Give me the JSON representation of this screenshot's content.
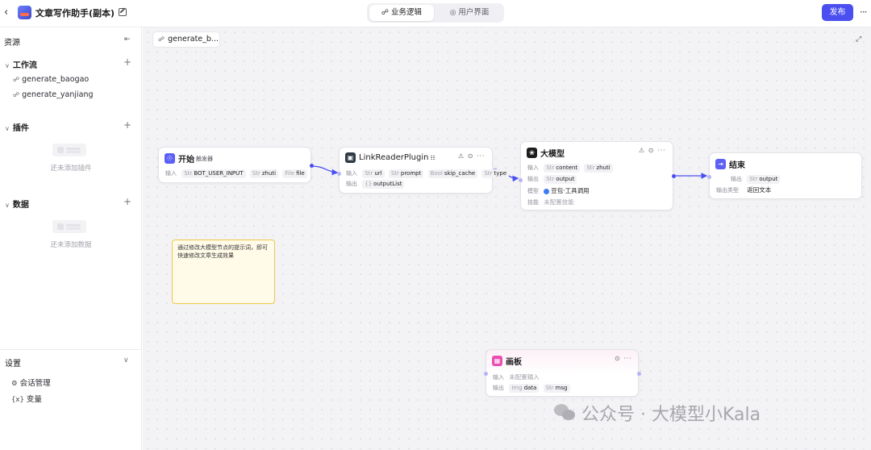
{
  "topbar": {
    "back_icon": "chevron-left-icon",
    "app_title": "文章写作助手(副本)",
    "tabs": [
      {
        "label": "业务逻辑",
        "icon": "workflow-icon",
        "active": true
      },
      {
        "label": "用户界面",
        "icon": "palette-icon",
        "active": false
      }
    ],
    "publish_label": "发布",
    "more_label": "···"
  },
  "sidebar": {
    "header": "资源",
    "workflow": {
      "title": "工作流",
      "items": [
        "generate_baogao",
        "generate_yanjiang"
      ]
    },
    "plugins": {
      "title": "插件",
      "empty_text": "还未添加插件"
    },
    "data": {
      "title": "数据",
      "empty_text": "还未添加数据"
    },
    "settings": {
      "title": "设置",
      "items": [
        {
          "label": "会话管理",
          "icon": "chat-settings-icon",
          "glyph": "⚙"
        },
        {
          "label": "变量",
          "icon": "variable-icon",
          "glyph": "{x}"
        }
      ]
    }
  },
  "canvas": {
    "breadcrumb": "generate_b...",
    "nodes": {
      "start": {
        "title": "开始",
        "badge": "触发器",
        "input_label": "输入",
        "inputs": [
          {
            "type": "Str",
            "name": "BOT_USER_INPUT"
          },
          {
            "type": "Str",
            "name": "zhuti"
          },
          {
            "type": "File",
            "name": "file"
          }
        ]
      },
      "plugin": {
        "title": "LinkReaderPlugin",
        "actions": "⚠ ⊙ ···",
        "input_label": "输入",
        "output_label": "输出",
        "inputs": [
          {
            "type": "Str",
            "name": "url"
          },
          {
            "type": "Str",
            "name": "prompt"
          },
          {
            "type": "Bool",
            "name": "skip_cache"
          },
          {
            "type": "Str",
            "name": "type"
          }
        ],
        "outputs": [
          {
            "type": "{}",
            "name": "outputList"
          }
        ]
      },
      "llm": {
        "title": "大模型",
        "actions": "⚠ ⊙ ···",
        "input_label": "输入",
        "output_label": "输出",
        "model_label": "模型",
        "skill_label": "技能",
        "inputs": [
          {
            "type": "Str",
            "name": "content"
          },
          {
            "type": "Str",
            "name": "zhuti"
          }
        ],
        "outputs": [
          {
            "type": "Str",
            "name": "output"
          }
        ],
        "model_value": "豆包·工具调用",
        "skill_value": "未配置技能"
      },
      "end": {
        "title": "结束",
        "output_label": "输出",
        "output_type_label": "输出类型",
        "outputs": [
          {
            "type": "Str",
            "name": "output"
          }
        ],
        "output_type_value": "返回文本"
      },
      "canvas_node": {
        "title": "画板",
        "actions": "⊙ ···",
        "input_label": "输入",
        "output_label": "输出",
        "input_value": "未配置输入",
        "outputs": [
          {
            "type": "Img",
            "name": "data"
          },
          {
            "type": "Str",
            "name": "msg"
          }
        ]
      }
    },
    "note": "通过修改大模型节点的提示词，即可快速修改文章生成效果"
  },
  "watermark": "公众号 · 大模型小Kala",
  "colors": {
    "accent": "#4b4ff0",
    "note_bg": "#fffbe8",
    "note_border": "#f0c64a",
    "canvas_bg": "#f3f3f6"
  }
}
